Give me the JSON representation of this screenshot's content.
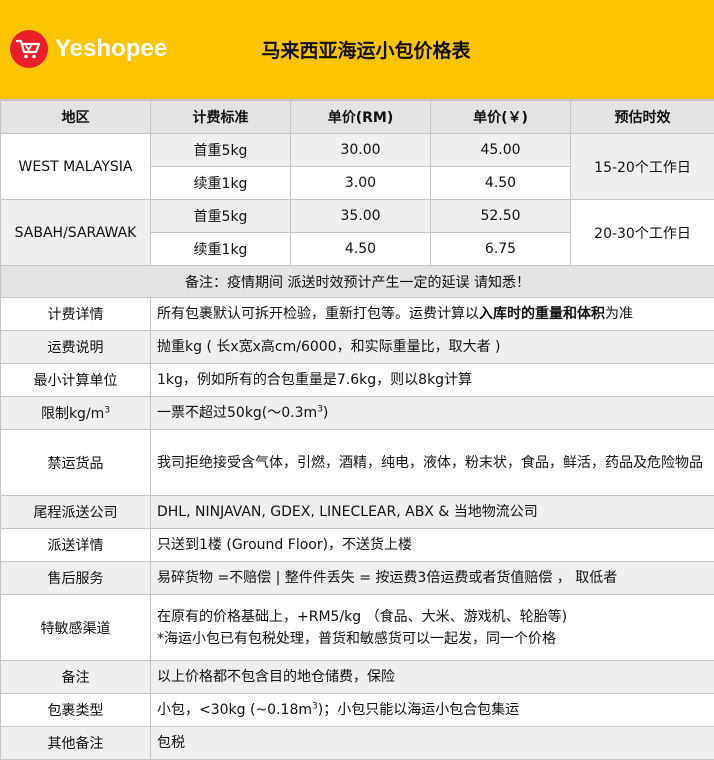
{
  "header": {
    "logo_text": "Yeshopee",
    "title": "马来西亚海运小包价格表",
    "bg_color": "#fcc402",
    "logo_color": "#e8202a"
  },
  "price_table": {
    "columns": [
      "地区",
      "计费标准",
      "单价(RM)",
      "单价(￥)",
      "预估时效"
    ],
    "regions": [
      {
        "name": "WEST MALAYSIA",
        "time": "15-20个工作日",
        "rows": [
          {
            "standard": "首重5kg",
            "rm": "30.00",
            "cny": "45.00"
          },
          {
            "standard": "续重1kg",
            "rm": "3.00",
            "cny": "4.50"
          }
        ]
      },
      {
        "name": "SABAH/SARAWAK",
        "time": "20-30个工作日",
        "rows": [
          {
            "standard": "首重5kg",
            "rm": "35.00",
            "cny": "52.50"
          },
          {
            "standard": "续重1kg",
            "rm": "4.50",
            "cny": "6.75"
          }
        ]
      }
    ],
    "note": "备注：疫情期间 派送时效预计产生一定的延误 请知悉！"
  },
  "details": {
    "billing": {
      "label": "计费详情",
      "value_pre": "所有包裹默认可拆开检验，重新打包等。运费计算以",
      "value_bold": "入库时的重量和体积",
      "value_post": "为准"
    },
    "freight": {
      "label": "运费说明",
      "value": "抛重kg ( 长x宽x高cm/6000，和实际重量比，取大者 )"
    },
    "min_unit": {
      "label": "最小计算单位",
      "value": "1kg，例如所有的合包重量是7.6kg，则以8kg计算"
    },
    "limit": {
      "label": "限制kg/m",
      "label_sup": "3",
      "value": "一票不超过50kg(～0.3m",
      "value_sup": "3",
      "value_end": ")"
    },
    "prohibited": {
      "label": "禁运货品",
      "value": "我司拒绝接受含气体，引燃，酒精，纯电，液体，粉末状，食品，鲜活，药品及危险物品"
    },
    "carriers": {
      "label": "尾程派送公司",
      "value": "DHL, NINJAVAN, GDEX, LINECLEAR, ABX & 当地物流公司"
    },
    "delivery": {
      "label": "派送详情",
      "value": "只送到1楼 (Ground Floor)，不送货上楼"
    },
    "after_sales": {
      "label": "售后服务",
      "value": "易碎货物 =不赔偿 | 整件件丢失 = 按运费3倍运费或者货值赔偿 ， 取低者"
    },
    "sensitive": {
      "label": "特敏感渠道",
      "line1": "在原有的价格基础上，+RM5/kg  （食品、大米、游戏机、轮胎等)",
      "line2": "*海运小包已有包税处理，普货和敏感货可以一起发，同一个价格"
    },
    "remark": {
      "label": "备注",
      "value": "以上价格都不包含目的地仓储费，保险"
    },
    "package_type": {
      "label": "包裹类型",
      "value_pre": "小包，<30kg (~0.18m",
      "value_sup": "3",
      "value_post": ")；小包只能以海运小包合包集运"
    },
    "other": {
      "label": "其他备注",
      "value": "包税"
    }
  }
}
